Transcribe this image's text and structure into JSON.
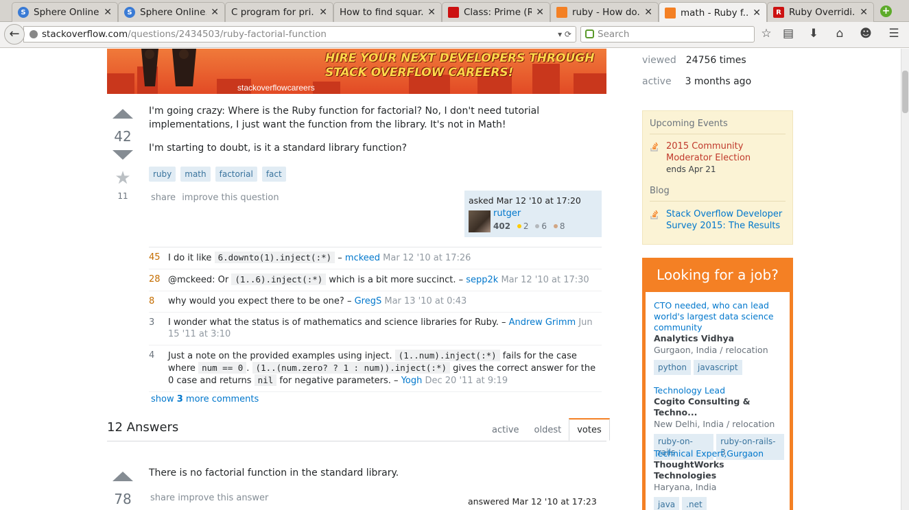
{
  "browser": {
    "tabs": [
      {
        "title": "Sphere Online...",
        "favicon": "sphere-icon",
        "color": "#3a7bd5"
      },
      {
        "title": "Sphere Online...",
        "favicon": "sphere-icon",
        "color": "#3a7bd5"
      },
      {
        "title": "C program for pri...",
        "favicon": "blank-icon",
        "color": "#d6d3ce"
      },
      {
        "title": "How to find squar...",
        "favicon": "blank-icon",
        "color": "#d6d3ce"
      },
      {
        "title": "Class: Prime (R...",
        "favicon": "ruby-icon",
        "color": "#cc1111"
      },
      {
        "title": "ruby - How do...",
        "favicon": "stackoverflow-icon",
        "color": "#f48024"
      },
      {
        "title": "math - Ruby f...",
        "favicon": "stackoverflow-icon",
        "color": "#f48024",
        "active": true
      },
      {
        "title": "Ruby Overridi...",
        "favicon": "rubyonrails-icon",
        "color": "#cc1111"
      }
    ],
    "url_host": "stackoverflow.com",
    "url_path": "/questions/2434503/ruby-factorial-function",
    "search_placeholder": "Search"
  },
  "banner": {
    "line1": "HIRE YOUR NEXT DEVELOPERS THROUGH",
    "line2": "STACK OVERFLOW CAREERS!",
    "logo": "stackoverflowcareers"
  },
  "question": {
    "votes": "42",
    "favorites": "11",
    "body_p1": "I'm going crazy: Where is the Ruby function for factorial? No, I don't need tutorial implementations, I just want the function from the library. It's not in Math!",
    "body_p2": "I'm starting to doubt, is it a standard library function?",
    "tags": [
      "ruby",
      "math",
      "factorial",
      "fact"
    ],
    "menu_share": "share",
    "menu_improve": "improve this question",
    "asked_label": "asked Mar 12 '10 at 17:20",
    "user": "rutger",
    "rep": "402",
    "gold": "2",
    "silver": "6",
    "bronze": "8"
  },
  "comments": [
    {
      "score": "45",
      "pre": "I do it like ",
      "code": "6.downto(1).inject(:*)",
      "post": " – ",
      "user": "mckeed",
      "date": " Mar 12 '10 at 17:26"
    },
    {
      "score": "28",
      "pre": "@mckeed: Or ",
      "code": "(1..6).inject(:*)",
      "post": " which is a bit more succinct. – ",
      "user": "sepp2k",
      "date": " Mar 12 '10 at 17:30"
    },
    {
      "score": "8",
      "pre": "why would you expect there to be one? – ",
      "code": "",
      "post": "",
      "user": "GregS",
      "date": " Mar 13 '10 at 0:43"
    },
    {
      "score": "3",
      "pre": "I wonder what the status is of mathematics and science libraries for Ruby. – ",
      "code": "",
      "post": "",
      "user": "Andrew Grimm",
      "date": " Jun 15 '11 at 3:10"
    }
  ],
  "comment5": {
    "score": "4",
    "t1": "Just a note on the provided examples using inject. ",
    "c1": "(1..num).inject(:*)",
    "t2": " fails for the case where ",
    "c2": "num == 0",
    "t3": ". ",
    "c3": "(1..(num.zero? ? 1 : num)).inject(:*)",
    "t4": " gives the correct answer for the 0 case and returns ",
    "c4": "nil",
    "t5": " for negative parameters. – ",
    "user": "Yogh",
    "date": " Dec 20 '11 at 9:19"
  },
  "show_more": {
    "pre": "show ",
    "count": "3",
    "post": " more comments"
  },
  "answers": {
    "heading": "12 Answers",
    "sort_tabs": [
      "active",
      "oldest",
      "votes"
    ],
    "first": {
      "votes": "78",
      "body": "There is no factorial function in the standard library.",
      "menu_share": "share",
      "menu_improve": "improve this answer",
      "answered_label": "answered Mar 12 '10 at 17:23"
    }
  },
  "sidebar": {
    "viewed_label": "viewed",
    "viewed_value": "24756 times",
    "active_label": "active",
    "active_value": "3 months ago",
    "events_heading": "Upcoming Events",
    "event_title": "2015 Community Moderator Election",
    "event_sub": "ends Apr 21",
    "blog_heading": "Blog",
    "blog_title": "Stack Overflow Developer Survey 2015: The Results",
    "jobs_heading": "Looking for a job?",
    "jobs": [
      {
        "role": "CTO needed, who can lead world's largest data science community",
        "company": "Analytics Vidhya",
        "location": "Gurgaon, India / relocation",
        "tags": [
          "python",
          "javascript"
        ]
      },
      {
        "role": "Technology Lead",
        "company": "Cogito Consulting & Techno...",
        "location": "New Delhi, India / relocation",
        "tags": [
          "ruby-on-rails",
          "ruby-on-rails-3"
        ]
      },
      {
        "role": "Technical Expert,Gurgaon",
        "company": "ThoughtWorks Technologies",
        "location": "Haryana, India",
        "tags": [
          "java",
          ".net"
        ]
      }
    ]
  },
  "colors": {
    "accent": "#f48024",
    "link": "#0077cc",
    "tag_bg": "#e1ecf4"
  }
}
